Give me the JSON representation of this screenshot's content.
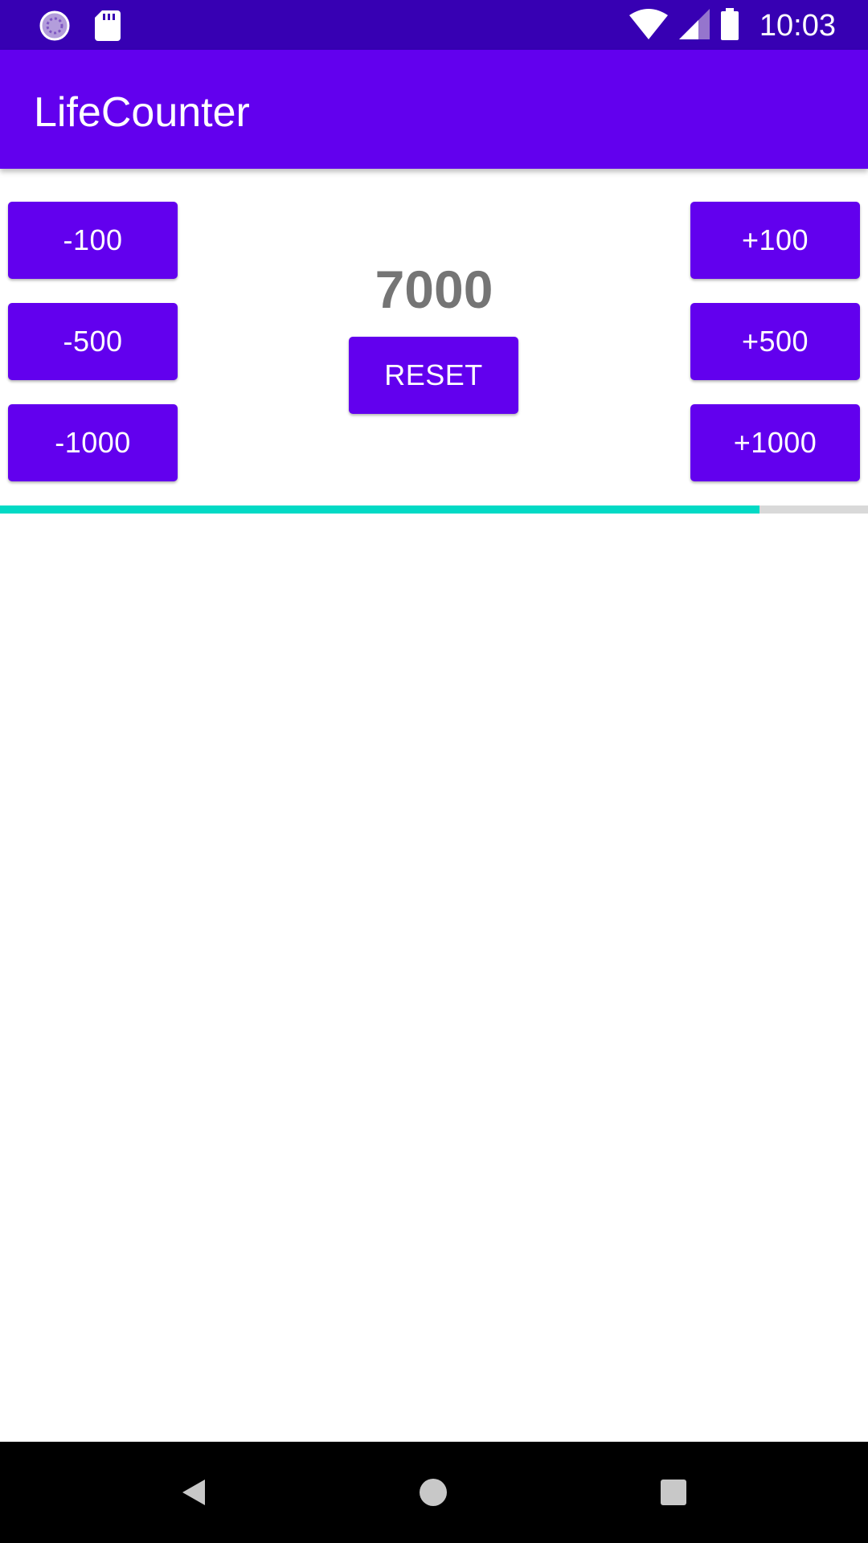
{
  "status_bar": {
    "time": "10:03",
    "left_icons": [
      "sync-icon",
      "sd-card-icon"
    ],
    "right_icons": [
      "wifi-icon",
      "cell-signal-icon",
      "battery-icon"
    ]
  },
  "app_bar": {
    "title": "LifeCounter",
    "color": "#6200ee"
  },
  "counter": {
    "value": "7000",
    "progress_fraction": 0.875
  },
  "buttons": {
    "minus_100": "-100",
    "minus_500": "-500",
    "minus_1000": "-1000",
    "plus_100": "+100",
    "plus_500": "+500",
    "plus_1000": "+1000",
    "reset": "RESET"
  },
  "colors": {
    "primary": "#6200ee",
    "primary_dark": "#3700b3",
    "accent": "#03dac5",
    "counter_text": "#757575"
  },
  "nav_bar": {
    "icons": [
      "back-icon",
      "home-icon",
      "recents-icon"
    ]
  }
}
